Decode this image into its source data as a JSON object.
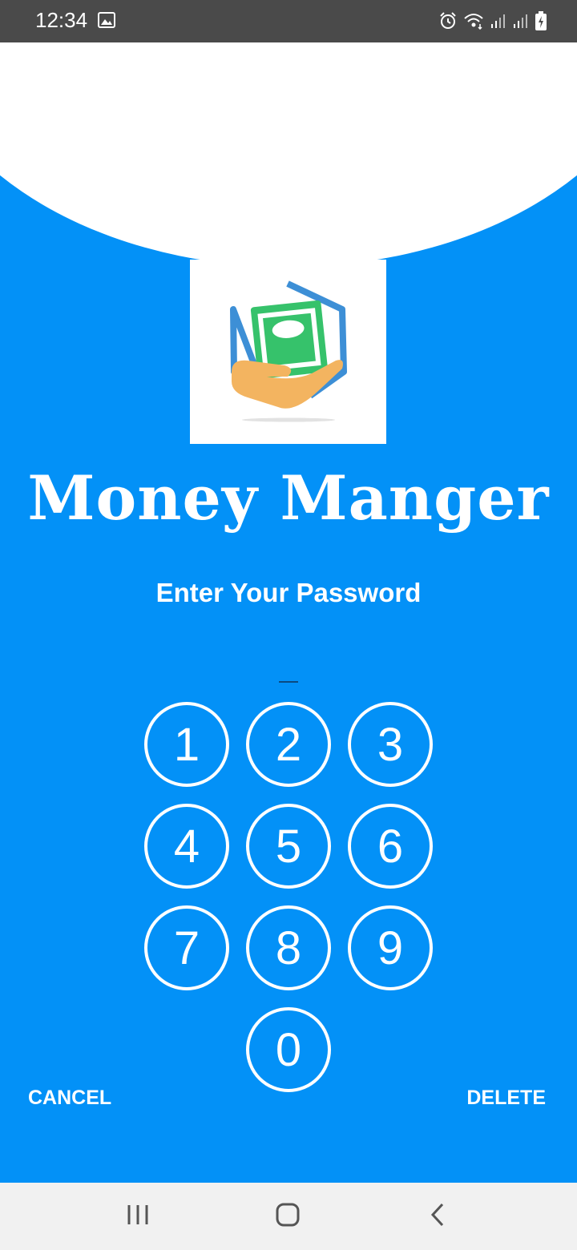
{
  "status_bar": {
    "time": "12:34",
    "icons": [
      "image-icon",
      "alarm-icon",
      "wifi-icon",
      "signal-icon",
      "signal-icon",
      "battery-charging-icon"
    ]
  },
  "app": {
    "title": "Money Manger",
    "prompt": "Enter Your Password",
    "accent_color": "#0391f7"
  },
  "keypad": {
    "keys": [
      "1",
      "2",
      "3",
      "4",
      "5",
      "6",
      "7",
      "8",
      "9",
      "0"
    ]
  },
  "actions": {
    "cancel_label": "CANCEL",
    "delete_label": "DELETE"
  },
  "nav": {
    "icons": [
      "recent-apps-icon",
      "home-icon",
      "back-icon"
    ]
  }
}
